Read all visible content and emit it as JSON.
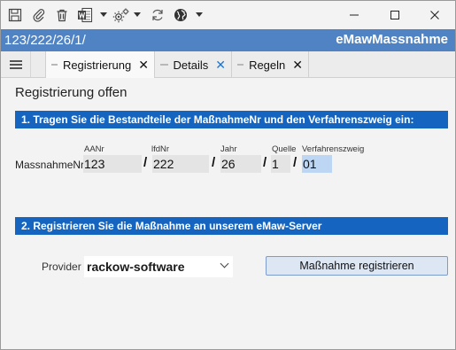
{
  "titlebar": {
    "icons": [
      "save-icon",
      "paperclip-icon",
      "trash-icon",
      "word-icon",
      "gears-icon",
      "refresh-icon",
      "globe-icon"
    ],
    "window_buttons": [
      "minimize",
      "maximize",
      "close"
    ]
  },
  "header": {
    "path": "123/222/26/1/",
    "app_name": "eMawMassnahme"
  },
  "tabs": [
    {
      "label": "Registrierung",
      "active": true
    },
    {
      "label": "Details",
      "active": false
    },
    {
      "label": "Regeln",
      "active": false
    }
  ],
  "main": {
    "title": "Registrierung offen",
    "section1": "1. Tragen Sie die Bestandteile der MaßnahmeNr und den Verfahrenszweig ein:",
    "row_label": "MassnahmeNr",
    "fields": [
      {
        "label": "AANr",
        "value": "123"
      },
      {
        "label": "lfdNr",
        "value": "222"
      },
      {
        "label": "Jahr",
        "value": "26"
      },
      {
        "label": "Quelle",
        "value": "1"
      },
      {
        "label": "Verfahrenszweig",
        "value": "01"
      }
    ],
    "separator": "/",
    "section2": "2. Registrieren Sie die Maßnahme an unserem eMaw-Server",
    "provider_label": "Provider",
    "provider_value": "rackow-software",
    "register_button": "Maßnahme registrieren"
  },
  "colors": {
    "header_bg": "#4f83c4",
    "section_bg": "#1565c0",
    "field_bg": "#e4e4e4",
    "selected_field_bg": "#bcd6f3",
    "tab_close_active": "#1976d2"
  }
}
